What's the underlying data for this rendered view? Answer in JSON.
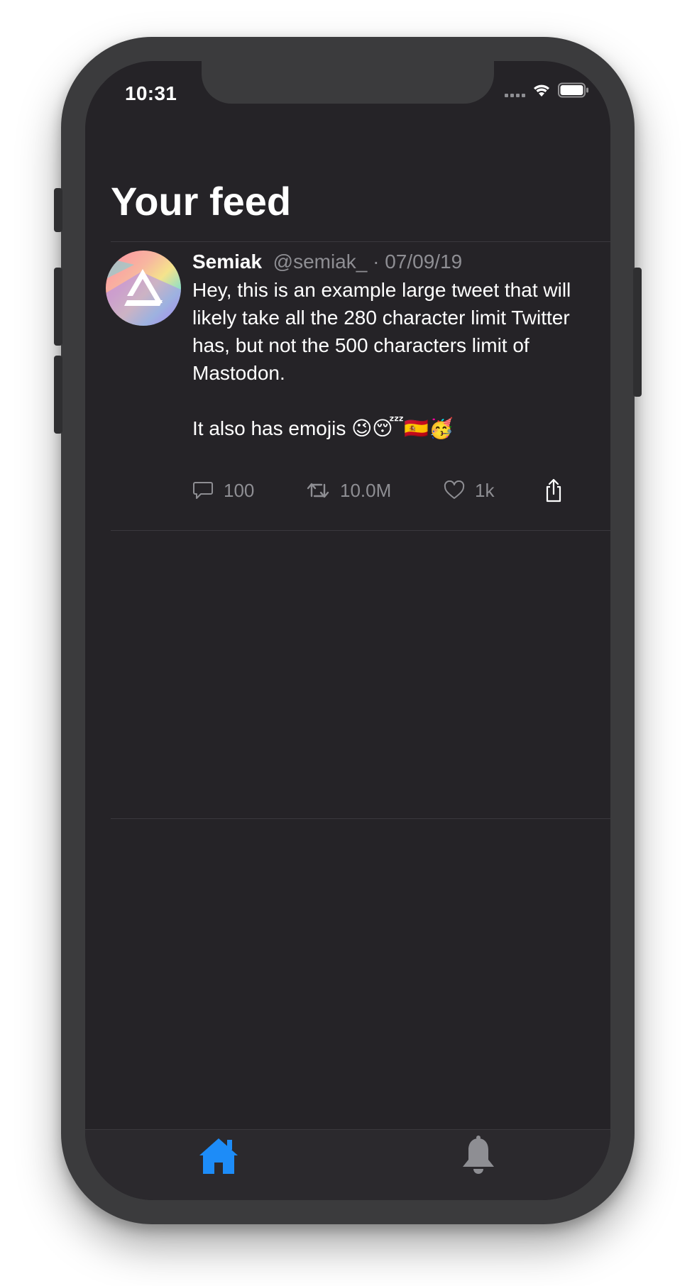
{
  "status_bar": {
    "time": "10:31"
  },
  "header": {
    "title": "Your feed"
  },
  "tweet": {
    "author_name": "Semiak",
    "author_handle": "@semiak_",
    "separator": "·",
    "date": "07/09/19",
    "text_paragraph_1": "Hey, this is an example large tweet that will likely take all the 280 character limit Twitter has, but not the 500 characters limit of Mastodon.",
    "text_paragraph_2": "It also has emojis 😉😴🇪🇸🥳",
    "replies": "100",
    "retweets": "10.0M",
    "likes": "1k"
  },
  "tab_bar": {
    "active_tab": "home",
    "tabs": [
      {
        "icon": "home-icon",
        "active": true
      },
      {
        "icon": "bell-icon",
        "active": false
      }
    ]
  },
  "colors": {
    "background": "#252327",
    "accent": "#1d8cf8",
    "secondary_text": "#8e8e93",
    "inactive_tab": "#8e8e93"
  }
}
